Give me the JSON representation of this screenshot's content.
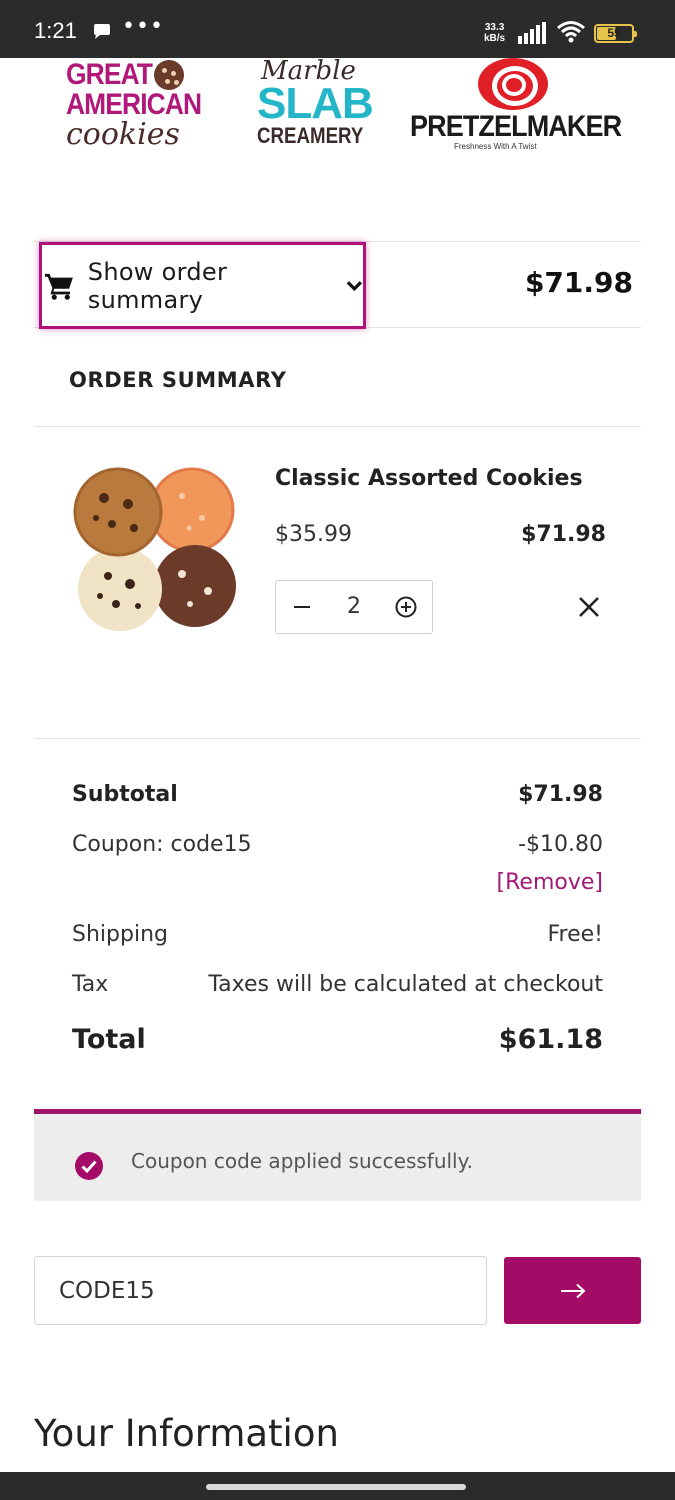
{
  "status_bar": {
    "time": "1:21",
    "more": "•••",
    "net_speed_value": "33.3",
    "net_speed_unit": "kB/s",
    "battery": "55"
  },
  "brands": {
    "gac_line1": "GREAT",
    "gac_line2": "AMERICAN",
    "gac_line3": "cookies",
    "marble_line1": "Marble",
    "marble_line2": "SLAB",
    "marble_line3": "CREAMERY",
    "pretzel_name": "PRETZELMAKER",
    "pretzel_tagline": "Freshness With A Twist"
  },
  "summary_toggle": {
    "label": "Show order summary",
    "total": "$71.98"
  },
  "order_summary": {
    "heading": "ORDER SUMMARY",
    "item": {
      "name": "Classic Assorted Cookies",
      "unit_price": "$35.99",
      "line_total": "$71.98",
      "quantity": "2"
    }
  },
  "totals": {
    "subtotal_label": "Subtotal",
    "subtotal_value": "$71.98",
    "coupon_label": "Coupon: code15",
    "coupon_value": "-$10.80",
    "remove_label": "[Remove]",
    "shipping_label": "Shipping",
    "shipping_value": "Free!",
    "tax_label": "Tax",
    "tax_value": "Taxes will be calculated at checkout",
    "total_label": "Total",
    "total_value": "$61.18"
  },
  "coupon": {
    "success_message": "Coupon code applied successfully.",
    "input_value": "CODE15"
  },
  "section_heading": "Your Information",
  "colors": {
    "accent": "#a30b67",
    "highlight_border": "#b0127a",
    "banner_bg": "#ededed"
  }
}
